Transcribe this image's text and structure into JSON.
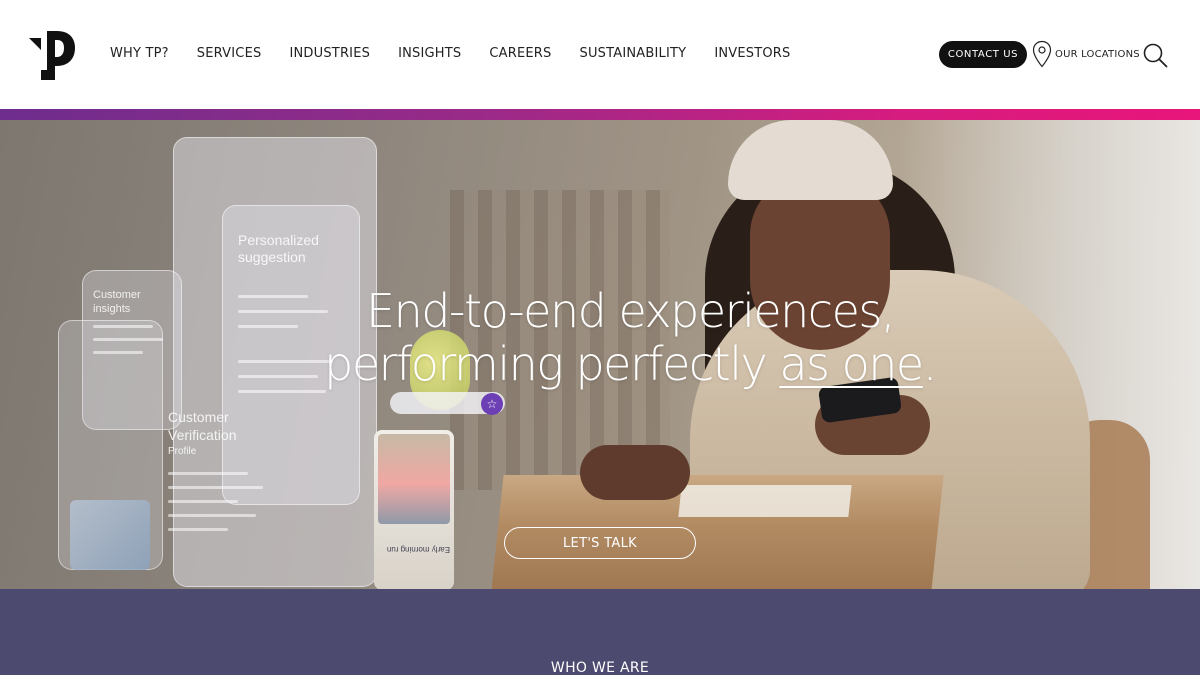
{
  "header": {
    "nav": [
      "WHY TP?",
      "SERVICES",
      "INDUSTRIES",
      "INSIGHTS",
      "CAREERS",
      "SUSTAINABILITY",
      "INVESTORS"
    ],
    "contact_label": "CONTACT US",
    "locations_label": "OUR LOCATIONS",
    "icons": {
      "logo": "tp-logo",
      "location": "map-pin-icon",
      "search": "search-icon"
    }
  },
  "hero": {
    "title_line1": "End-to-end experiences,",
    "title_line2_start": "performing perfectly ",
    "title_line2_underlined": "as one",
    "title_line2_end": ".",
    "cta_label": "LET'S TALK",
    "overlay": {
      "panel1_title": "Personalized suggestion",
      "panel2_title": "Customer insights",
      "panel3_title": "Customer Verification",
      "panel3_sub": "Profile",
      "card_caption": "Early morning run"
    }
  },
  "colors": {
    "band_start": "#6e2d8d",
    "band_end": "#e8157a",
    "section_bg": "#4c4a6e",
    "button_bg": "#111111"
  },
  "section": {
    "label": "WHO WE ARE"
  }
}
